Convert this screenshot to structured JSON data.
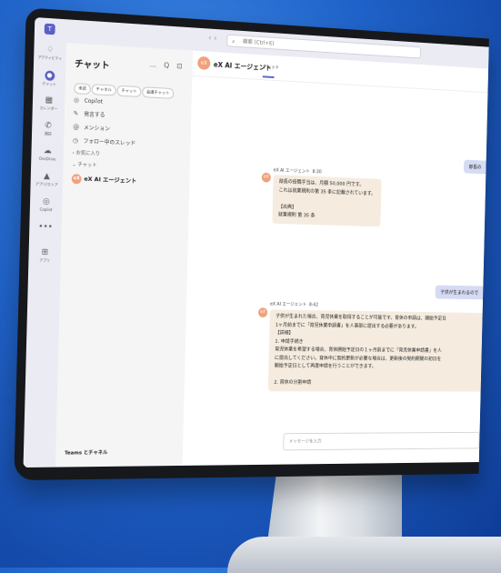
{
  "app": {
    "logo": "T",
    "search_placeholder": "検索 (Ctrl+E)",
    "nav": "‹  ›"
  },
  "rail": [
    {
      "icon": "bell-icon",
      "glyph": "♢",
      "label": "アクティビティ"
    },
    {
      "icon": "chat-icon",
      "glyph": "●",
      "label": "チャット",
      "active": true
    },
    {
      "icon": "calendar-icon",
      "glyph": "▦",
      "label": "カレンダー"
    },
    {
      "icon": "phone-icon",
      "glyph": "✆",
      "label": "通話"
    },
    {
      "icon": "cloud-icon",
      "glyph": "☁",
      "label": "OneDrive"
    },
    {
      "icon": "apps-icon",
      "glyph": "▲",
      "label": "アプリ/ストア"
    },
    {
      "icon": "copilot-icon",
      "glyph": "◎",
      "label": "Copilot"
    },
    {
      "icon": "more-icon",
      "glyph": "•••",
      "label": ""
    },
    {
      "icon": "add-app-icon",
      "glyph": "⊞",
      "label": "アプリ"
    }
  ],
  "chatlist": {
    "title": "チャット",
    "actions": "… Q ⊡",
    "filters": [
      "未読",
      "チャネル",
      "チャット",
      "会議チャット"
    ],
    "items": [
      {
        "icon": "copilot-icon",
        "glyph": "◎",
        "label": "Copilot"
      },
      {
        "icon": "mention-icon",
        "glyph": "✎",
        "label": "発言する"
      },
      {
        "icon": "at-icon",
        "glyph": "@",
        "label": "メンション"
      },
      {
        "icon": "thread-icon",
        "glyph": "◷",
        "label": "フォロー中のスレッド"
      }
    ],
    "favorites": "› お気に入り",
    "chats_section": "⌄ チャット",
    "agent_name": "eX AI エージェント",
    "footer": "Teams とチャネル"
  },
  "conversation": {
    "header_name": "eX AI エージェント",
    "header_tab": "チャット",
    "avatar_text": "eX",
    "user_msg_1": "部長の",
    "bot_1": {
      "name": "eX AI エージェント",
      "time": "8:30",
      "lines": [
        "部長の役職手当は、月額 50,000 円です。",
        "これは就業規則の第 35 条に記載されています。",
        "",
        "【出典】",
        "就業規則 第 35 条"
      ]
    },
    "user_msg_2": "子供が生まれるので",
    "bot_2": {
      "name": "eX AI エージェント",
      "time": "8:42",
      "lines": [
        "子供が生まれた場合、育児休業を取得することが可能です。育休の申請は、開始予定日",
        "1ヶ月前までに「育児休業申請書」を人事部に提出する必要があります。",
        "【詳細】",
        "1. 申請手続き",
        "育児休業を希望する場合、育休開始予定日の１ヶ月前までに「育児休業申請書」を人",
        "に提出してください。育休中に契約更新が必要な場合は、更新後の契約期間の初日を",
        "開始予定日として再度申請を行うことができます。",
        "",
        "2. 育休の分割申請"
      ]
    },
    "compose_placeholder": "メッセージを入力"
  }
}
